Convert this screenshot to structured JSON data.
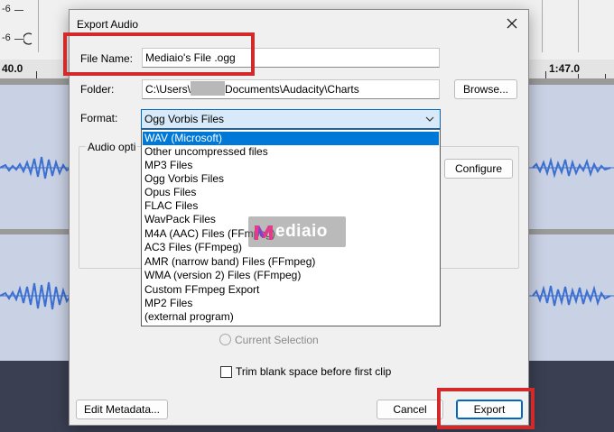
{
  "background": {
    "db_labels": [
      "-6",
      "-6"
    ],
    "ruler": {
      "left_label": "40.0",
      "right_label": "1:47.0"
    }
  },
  "dialog": {
    "title": "Export Audio",
    "close_icon": "close-icon",
    "file_name": {
      "label": "File Name:",
      "value": "Mediaio's File .ogg"
    },
    "folder": {
      "label": "Folder:",
      "value_prefix": "C:\\Users\\",
      "value_suffix": "Documents\\Audacity\\Charts",
      "browse_label": "Browse..."
    },
    "format": {
      "label": "Format:",
      "selected": "Ogg Vorbis Files",
      "options": [
        "WAV (Microsoft)",
        "Other uncompressed files",
        "MP3 Files",
        "Ogg Vorbis Files",
        "Opus Files",
        "FLAC Files",
        "WavPack Files",
        "M4A (AAC) Files (FFmpeg)",
        "AC3 Files (FFmpeg)",
        "AMR (narrow band) Files (FFmpeg)",
        "WMA (version 2) Files (FFmpeg)",
        "Custom FFmpeg Export",
        "MP2 Files",
        "(external program)"
      ],
      "highlighted_index": 0
    },
    "audio_options": {
      "title": "Audio opti",
      "configure_label": "Configure"
    },
    "current_selection_label": "Current Selection",
    "trim_label": "Trim blank space before first clip",
    "edit_metadata_label": "Edit Metadata...",
    "cancel_label": "Cancel",
    "export_label": "Export"
  },
  "watermark": {
    "text": "ediaio"
  },
  "colors": {
    "highlight_red": "#d22a2a",
    "selection_blue": "#0078d7",
    "waveform": "#3b6fd0",
    "track_bg": "#c9d1e4"
  }
}
